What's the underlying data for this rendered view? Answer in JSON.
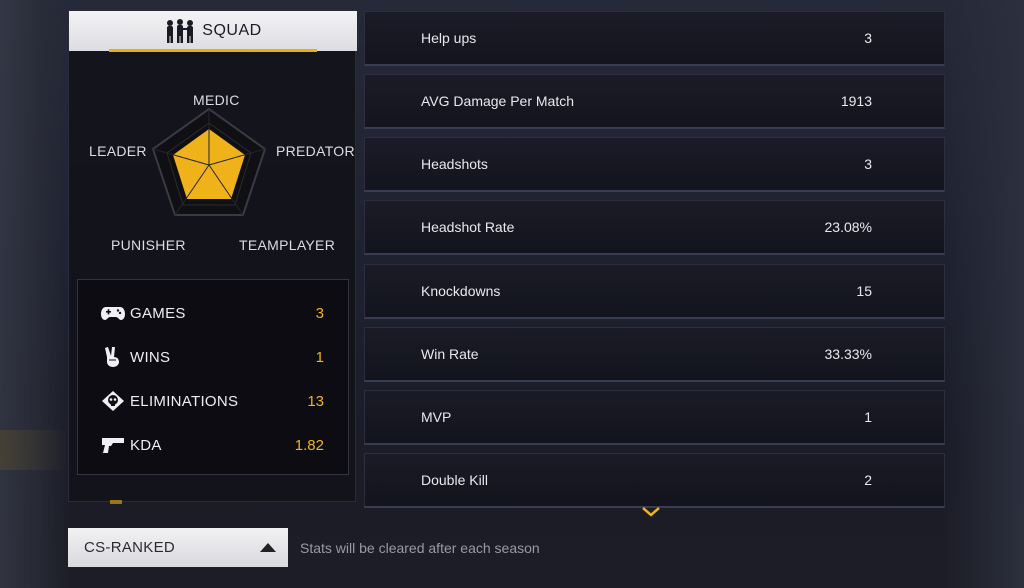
{
  "squad": {
    "title": "SQUAD",
    "icon": "squad-silhouettes-icon",
    "accent_color": "#e9b10a"
  },
  "radar": {
    "labels": {
      "medic": "MEDIC",
      "leader": "LEADER",
      "predator": "PREDATOR",
      "punisher": "PUNISHER",
      "teamplayer": "TEAMPLAYER"
    },
    "fill_color": "#f0b21a"
  },
  "summary": {
    "games": {
      "label": "GAMES",
      "value": "3",
      "icon": "gamepad-icon"
    },
    "wins": {
      "label": "WINS",
      "value": "1",
      "icon": "victory-hand-icon"
    },
    "eliminations": {
      "label": "ELIMINATIONS",
      "value": "13",
      "icon": "skull-badge-icon"
    },
    "kda": {
      "label": "KDA",
      "value": "1.82",
      "icon": "pistol-icon"
    }
  },
  "details": [
    {
      "name": "Help ups",
      "value": "3"
    },
    {
      "name": "AVG Damage Per Match",
      "value": "1913"
    },
    {
      "name": "Headshots",
      "value": "3"
    },
    {
      "name": "Headshot Rate",
      "value": "23.08%"
    },
    {
      "name": "Knockdowns",
      "value": "15"
    },
    {
      "name": "Win Rate",
      "value": "33.33%"
    },
    {
      "name": "MVP",
      "value": "1"
    },
    {
      "name": "Double Kill",
      "value": "2"
    }
  ],
  "mode": {
    "selected": "CS-RANKED"
  },
  "note": "Stats will be cleared after each season"
}
